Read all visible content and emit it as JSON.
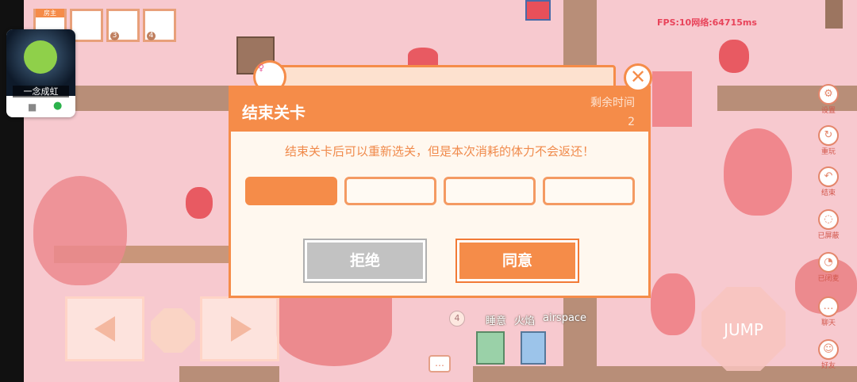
{
  "hud": {
    "fps": "FPS:10网络:64715ms",
    "host_badge": "房主",
    "player_badges": [
      "3",
      "4"
    ]
  },
  "video_call": {
    "name": "一念成虹",
    "camera_icon": "video-camera-icon",
    "mic_icon": "microphone-icon"
  },
  "side_menu": [
    {
      "label": "设置",
      "icon": "gear-icon"
    },
    {
      "label": "重玩",
      "icon": "replay-icon"
    },
    {
      "label": "结束",
      "icon": "exit-icon"
    },
    {
      "label": "已屏蔽",
      "icon": "block-icon"
    },
    {
      "label": "已闭麦",
      "icon": "mic-off-icon"
    },
    {
      "label": "聊天",
      "icon": "chat-icon"
    },
    {
      "label": "好友",
      "icon": "friends-icon"
    }
  ],
  "controls": {
    "left_icon": "arrow-left-icon",
    "right_icon": "arrow-right-icon",
    "jump_label": "JUMP"
  },
  "players": {
    "count_badge": "4",
    "name1": "睡意",
    "name2": "火焰",
    "name3": "airspace",
    "chat_icon": "chat-bubble-icon"
  },
  "dialog": {
    "title": "结束关卡",
    "remaining_label": "剩余时间",
    "remaining_value": "2",
    "message": "结束关卡后可以重新选关，但是本次消耗的体力不会返还！",
    "vote_segments": [
      true,
      false,
      false,
      false
    ],
    "refuse_label": "拒绝",
    "agree_label": "同意",
    "close_icon": "close-icon",
    "close_glyph": "✕",
    "requester_icon": "female-icon",
    "requester_glyph": "♀"
  },
  "colors": {
    "accent": "#f58c49",
    "background": "#f7c9cf",
    "refuse": "#c2c2c2"
  }
}
